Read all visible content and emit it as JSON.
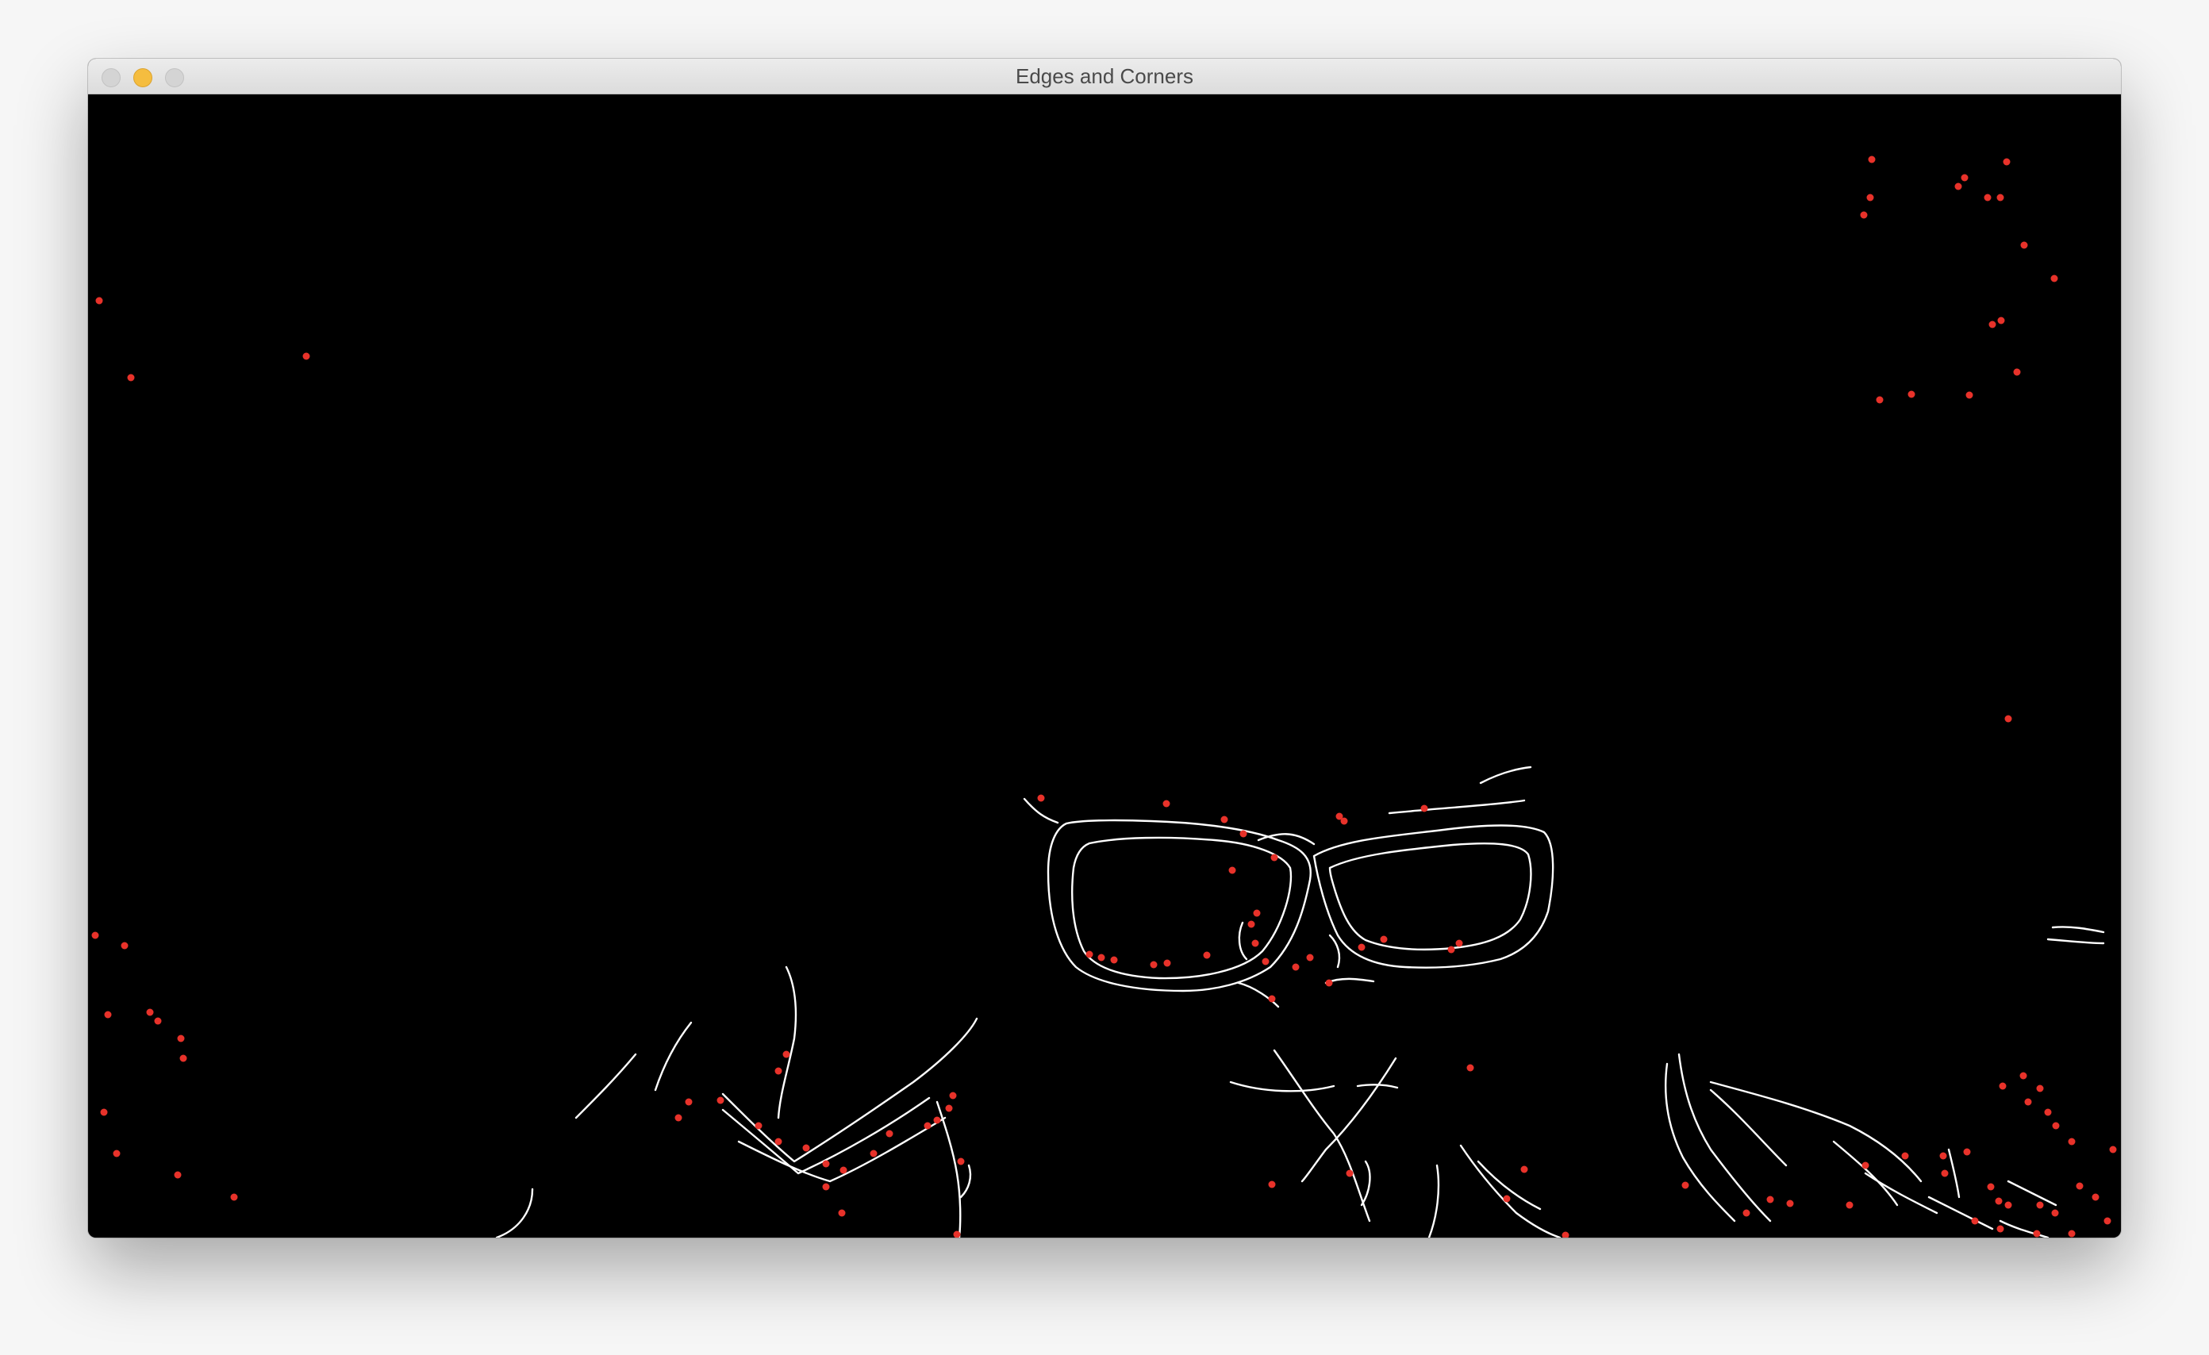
{
  "window": {
    "title": "Edges and Corners",
    "controls": [
      "close",
      "minimize",
      "zoom"
    ]
  },
  "image_view": {
    "background_color": "#000000",
    "edge_color": "#ffffff",
    "corner_color": "#e8322a",
    "content": "edge-and-corner-detection-output"
  }
}
